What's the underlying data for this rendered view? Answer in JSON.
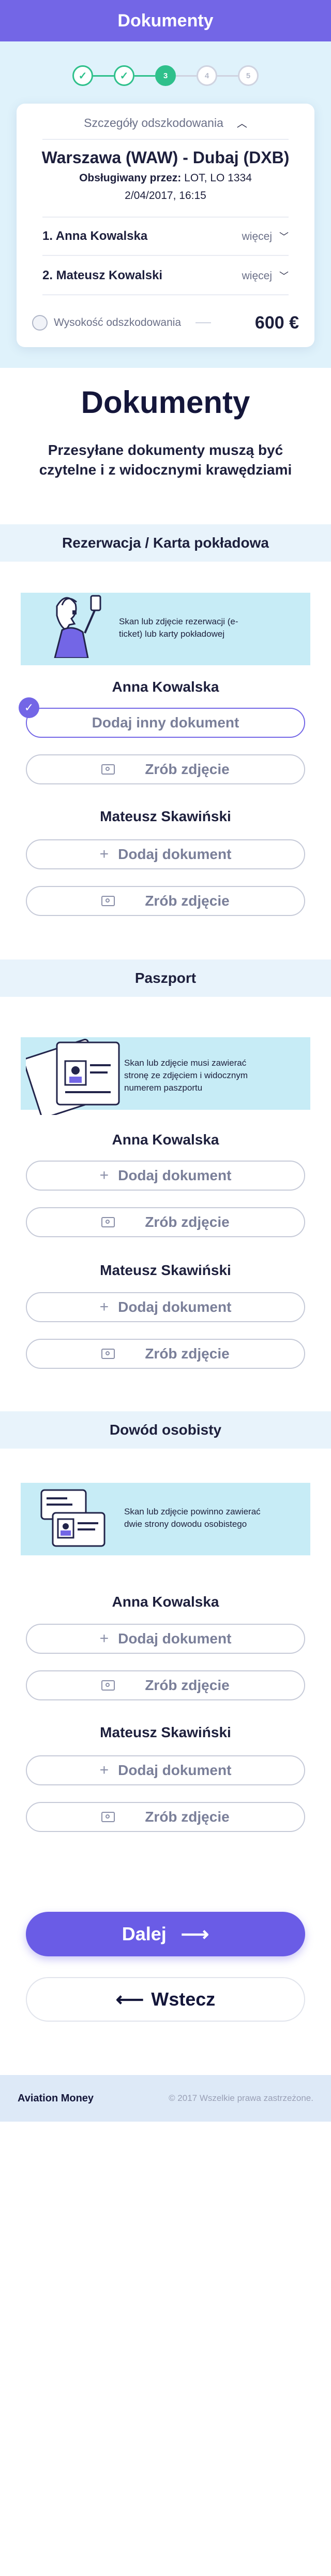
{
  "header": {
    "title": "Dokumenty"
  },
  "stepper": {
    "steps": [
      "✓",
      "✓",
      "3",
      "4",
      "5"
    ]
  },
  "summary": {
    "toggle_label": "Szczegóły odszkodowania",
    "route": "Warszawa (WAW) - Dubaj (DXB)",
    "operated_label": "Obsługiwany przez:",
    "operated_value": "LOT, LO 1334",
    "date": "2/04/2017, 16:15",
    "passengers": [
      {
        "label": "1. Anna Kowalska",
        "more": "więcej"
      },
      {
        "label": "2. Mateusz Kowalski",
        "more": "więcej"
      }
    ],
    "compensation_label": "Wysokość odszkodowania",
    "compensation_value": "600 €"
  },
  "page": {
    "title": "Dokumenty",
    "intro": "Przesyłane dokumenty muszą być czytelne i z widocznymi krawędziami"
  },
  "sections": {
    "booking": {
      "title": "Rezerwacja / Karta pokładowa",
      "info": "Skan lub zdjęcie rezerwacji (e-ticket) lub karty pokładowej",
      "people": [
        {
          "name": "Anna Kowalska",
          "add": "Dodaj inny dokument",
          "photo": "Zrób zdjęcie"
        },
        {
          "name": "Mateusz Skawiński",
          "add": "Dodaj dokument",
          "photo": "Zrób zdjęcie"
        }
      ]
    },
    "passport": {
      "title": "Paszport",
      "info": "Skan lub zdjęcie musi zawierać stronę ze zdjęciem i widocznym numerem paszportu",
      "people": [
        {
          "name": "Anna Kowalska",
          "add": "Dodaj dokument",
          "photo": "Zrób zdjęcie"
        },
        {
          "name": "Mateusz Skawiński",
          "add": "Dodaj dokument",
          "photo": "Zrób zdjęcie"
        }
      ]
    },
    "id_card": {
      "title": "Dowód osobisty",
      "info": "Skan lub zdjęcie powinno zawierać dwie strony dowodu osobistego",
      "people": [
        {
          "name": "Anna Kowalska",
          "add": "Dodaj dokument",
          "photo": "Zrób zdjęcie"
        },
        {
          "name": "Mateusz Skawiński",
          "add": "Dodaj dokument",
          "photo": "Zrób zdjęcie"
        }
      ]
    }
  },
  "actions": {
    "next": "Dalej",
    "back": "Wstecz"
  },
  "footer": {
    "brand": "Aviation Money",
    "copyright": "© 2017 Wszelkie prawa zastrzeżone."
  },
  "colors": {
    "primary": "#7366e6",
    "success": "#2fc08b",
    "hero_bg": "#dff2fb",
    "info_bg": "#c7ecf6"
  }
}
